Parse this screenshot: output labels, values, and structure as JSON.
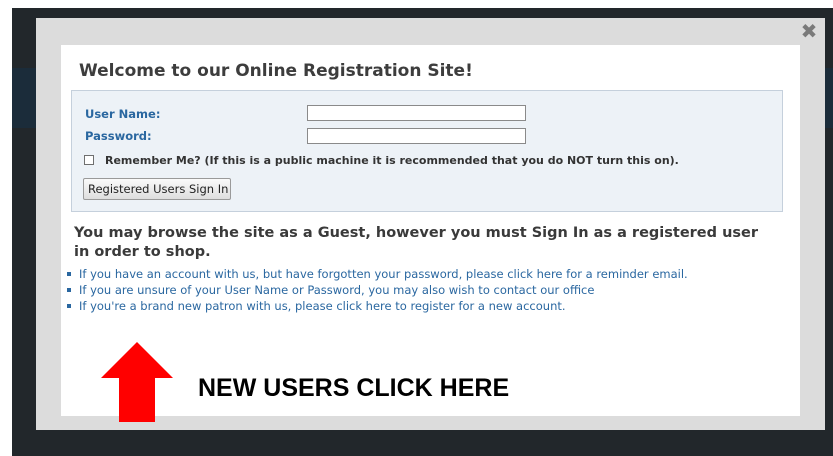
{
  "modal": {
    "close_glyph": "✖",
    "title": "Welcome to our Online Registration Site!"
  },
  "login": {
    "username_label": "User Name:",
    "username_value": "",
    "password_label": "Password:",
    "password_value": "",
    "remember_label": "Remember Me? (If this is a public machine it is recommended that you do NOT turn this on).",
    "remember_checked": false,
    "signin_button": "Registered Users Sign In"
  },
  "guest_message": "You may browse the site as a Guest, however you must Sign In as a registered user in order to shop.",
  "links": [
    "If you have an account with us, but have forgotten your password, please click here for a reminder email.",
    "If you are unsure of your User Name or Password, you may also wish to contact our office",
    "If you're a brand new patron with us, please click here to register for a new account."
  ],
  "annotation": {
    "text": "NEW USERS CLICK HERE",
    "arrow_color": "#ff0000",
    "arrow_direction": "up"
  },
  "colors": {
    "link": "#2a67a0",
    "label": "#2a67a0",
    "backdrop": "#22272b",
    "login_box_bg": "#edf2f7"
  }
}
